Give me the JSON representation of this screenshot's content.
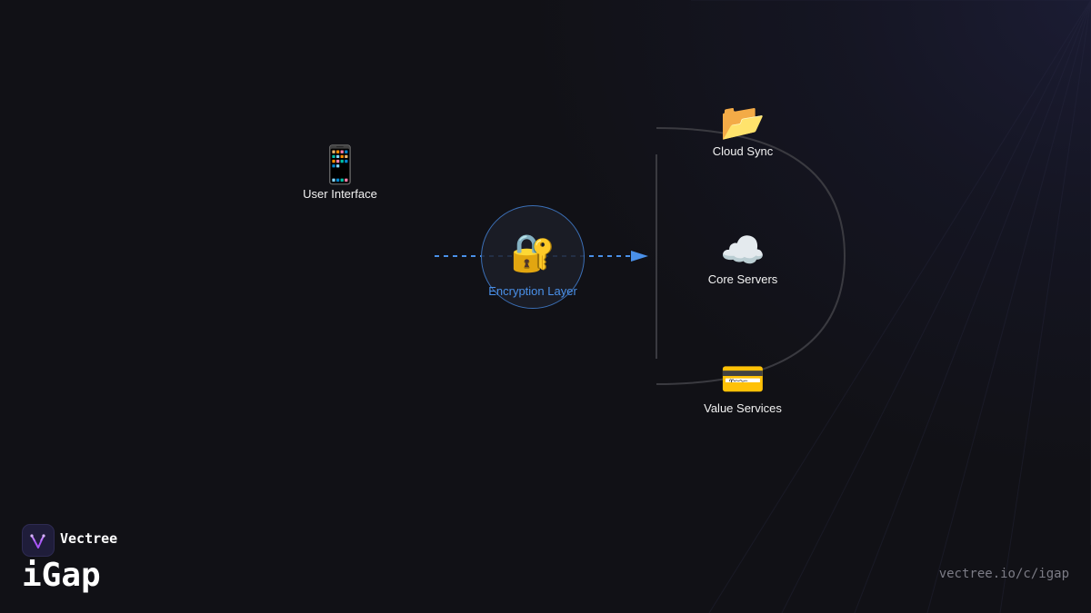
{
  "nodes": {
    "user_interface": {
      "label": "User Interface",
      "icon": "📱",
      "icon_name": "mobile-phone-icon"
    },
    "encryption_layer": {
      "label": "Encryption Layer",
      "icon": "🔐",
      "icon_name": "locked-with-key-icon"
    },
    "cloud_sync": {
      "label": "Cloud Sync",
      "icon": "📂",
      "icon_name": "open-folder-icon"
    },
    "core_servers": {
      "label": "Core Servers",
      "icon": "☁️",
      "icon_name": "cloud-icon"
    },
    "value_services": {
      "label": "Value Services",
      "icon": "💳",
      "icon_name": "credit-card-icon"
    }
  },
  "colors": {
    "accent": "#4a90e8",
    "background": "#111116",
    "connector": "#3a3a40"
  },
  "brand": {
    "name": "Vectree",
    "product": "iGap",
    "url": "vectree.io/c/igap"
  }
}
